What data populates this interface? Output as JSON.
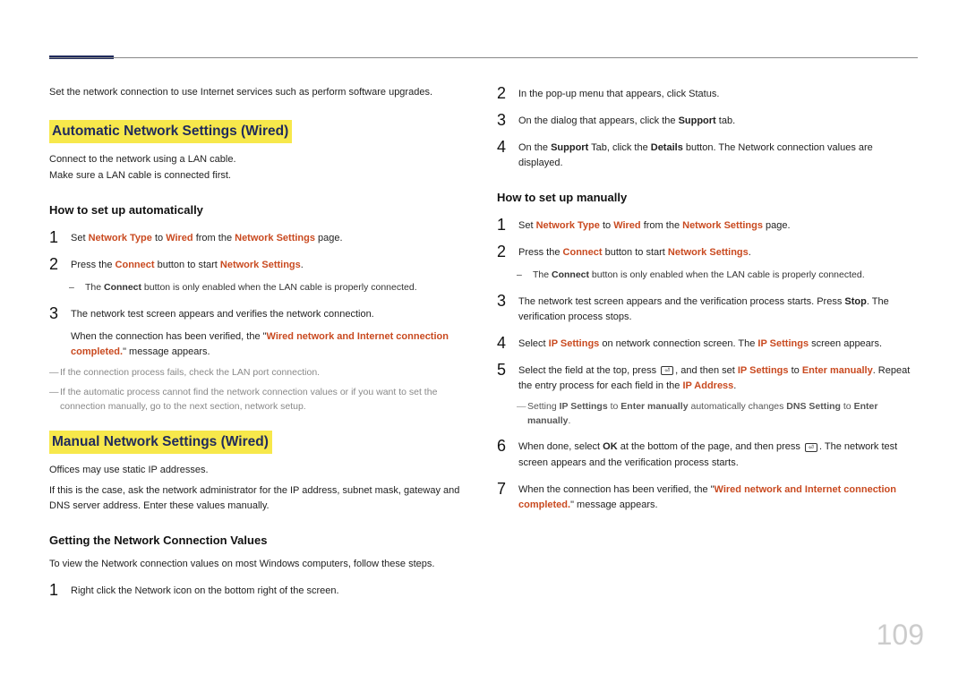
{
  "page_number": "109",
  "left": {
    "intro": "Set the network connection to use Internet services such as perform software upgrades.",
    "section1_title": "Automatic Network Settings (Wired)",
    "s1p1": "Connect to the network using a LAN cable.",
    "s1p2": "Make sure a LAN cable is connected first.",
    "sub1_title": "How to set up automatically",
    "s1step1_pre": "Set ",
    "s1step1_nt": "Network Type",
    "s1step1_mid1": " to ",
    "s1step1_wired": "Wired",
    "s1step1_mid2": " from the ",
    "s1step1_ns": "Network Settings",
    "s1step1_post": " page.",
    "s1step2_pre": "Press the ",
    "s1step2_connect": "Connect",
    "s1step2_mid": " button to start ",
    "s1step2_ns": "Network Settings",
    "s1step2_post": ".",
    "s1step2_dash_pre": "The ",
    "s1step2_dash_connect": "Connect",
    "s1step2_dash_post": " button is only enabled when the LAN cable is properly connected.",
    "s1step3a": "The network test screen appears and verifies the network connection.",
    "s1step3b_pre": "When the connection has been verified, the \"",
    "s1step3b_red": "Wired network and Internet connection completed.",
    "s1step3b_post": "\" message appears.",
    "s1note1": "If the connection process fails, check the LAN port connection.",
    "s1note2": "If the automatic process cannot find the network connection values or if you want to set the connection manually, go to the next section, network setup.",
    "section2_title": "Manual Network Settings (Wired)",
    "s2p1": "Offices may use static IP addresses.",
    "s2p2": "If this is the case, ask the network administrator for the IP address, subnet mask, gateway and DNS server address. Enter these values manually.",
    "sub2_title": "Getting the Network Connection Values",
    "s2intro": "To view the Network connection values on most Windows computers, follow these steps.",
    "s2step1": "Right click the Network icon on the bottom right of the screen."
  },
  "right": {
    "r2": "In the pop-up menu that appears, click Status.",
    "r3_pre": "On the dialog that appears, click the ",
    "r3_bold": "Support",
    "r3_post": " tab.",
    "r4_pre": "On the ",
    "r4_b1": "Support",
    "r4_mid": " Tab, click the ",
    "r4_b2": "Details",
    "r4_post": " button. The Network connection values are displayed.",
    "sub_title": "How to set up manually",
    "m1_pre": "Set ",
    "m1_nt": "Network Type",
    "m1_mid1": " to ",
    "m1_wired": "Wired",
    "m1_mid2": " from the ",
    "m1_ns": "Network Settings",
    "m1_post": " page.",
    "m2_pre": "Press the ",
    "m2_connect": "Connect",
    "m2_mid": " button to start ",
    "m2_ns": "Network Settings",
    "m2_post": ".",
    "m2_dash_pre": "The ",
    "m2_dash_connect": "Connect",
    "m2_dash_post": " button is only enabled when the LAN cable is properly connected.",
    "m3_pre": "The network test screen appears and the verification process starts. Press ",
    "m3_stop": "Stop",
    "m3_post": ". The verification process stops.",
    "m4_pre": "Select ",
    "m4_ip": "IP Settings",
    "m4_mid": " on network connection screen. The ",
    "m4_ip2": "IP Settings",
    "m4_post": " screen appears.",
    "m5_pre": "Select the field at the top, press ",
    "m5_mid1": ", and then set ",
    "m5_ip": "IP Settings",
    "m5_mid2": " to ",
    "m5_em": "Enter manually",
    "m5_mid3": ". Repeat the entry process for each field in the ",
    "m5_ipaddr": "IP Address",
    "m5_post": ".",
    "m5_note_pre": "Setting ",
    "m5_note_ip": "IP Settings",
    "m5_note_mid1": " to ",
    "m5_note_em1": "Enter manually",
    "m5_note_mid2": " automatically changes ",
    "m5_note_dns": "DNS Setting",
    "m5_note_mid3": " to ",
    "m5_note_em2": "Enter manually",
    "m5_note_post": ".",
    "m6_pre": "When done, select ",
    "m6_ok": "OK",
    "m6_mid": " at the bottom of the page, and then press ",
    "m6_post": ". The network test screen appears and the verification process starts.",
    "m7_pre": "When the connection has been verified, the \"",
    "m7_red": "Wired network and Internet connection completed.",
    "m7_post": "\" message appears."
  }
}
